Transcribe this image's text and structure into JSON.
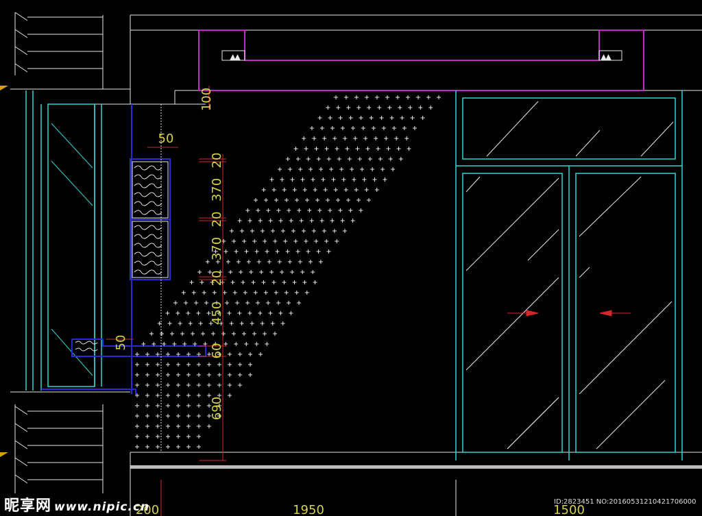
{
  "drawing": {
    "vertical_dims": [
      "20",
      "370",
      "20",
      "370",
      "20",
      "450",
      "60",
      "690"
    ],
    "top_dim": "100",
    "shelf_dim": "50",
    "upper_dim": "50",
    "bottom_dims": [
      "200",
      "1950",
      "1500"
    ]
  },
  "colors": {
    "background": "#000000",
    "cyan": "#2fd6d6",
    "magenta": "#c22ac8",
    "blue": "#2a2ad8",
    "red": "#d4272a",
    "yellow": "#d6d24a",
    "white": "#e8e8e8"
  },
  "watermark": {
    "brand": "昵享网",
    "url": "www.nipic.cn",
    "id_text": "ID:2823451 NO:20160531210421706000"
  }
}
